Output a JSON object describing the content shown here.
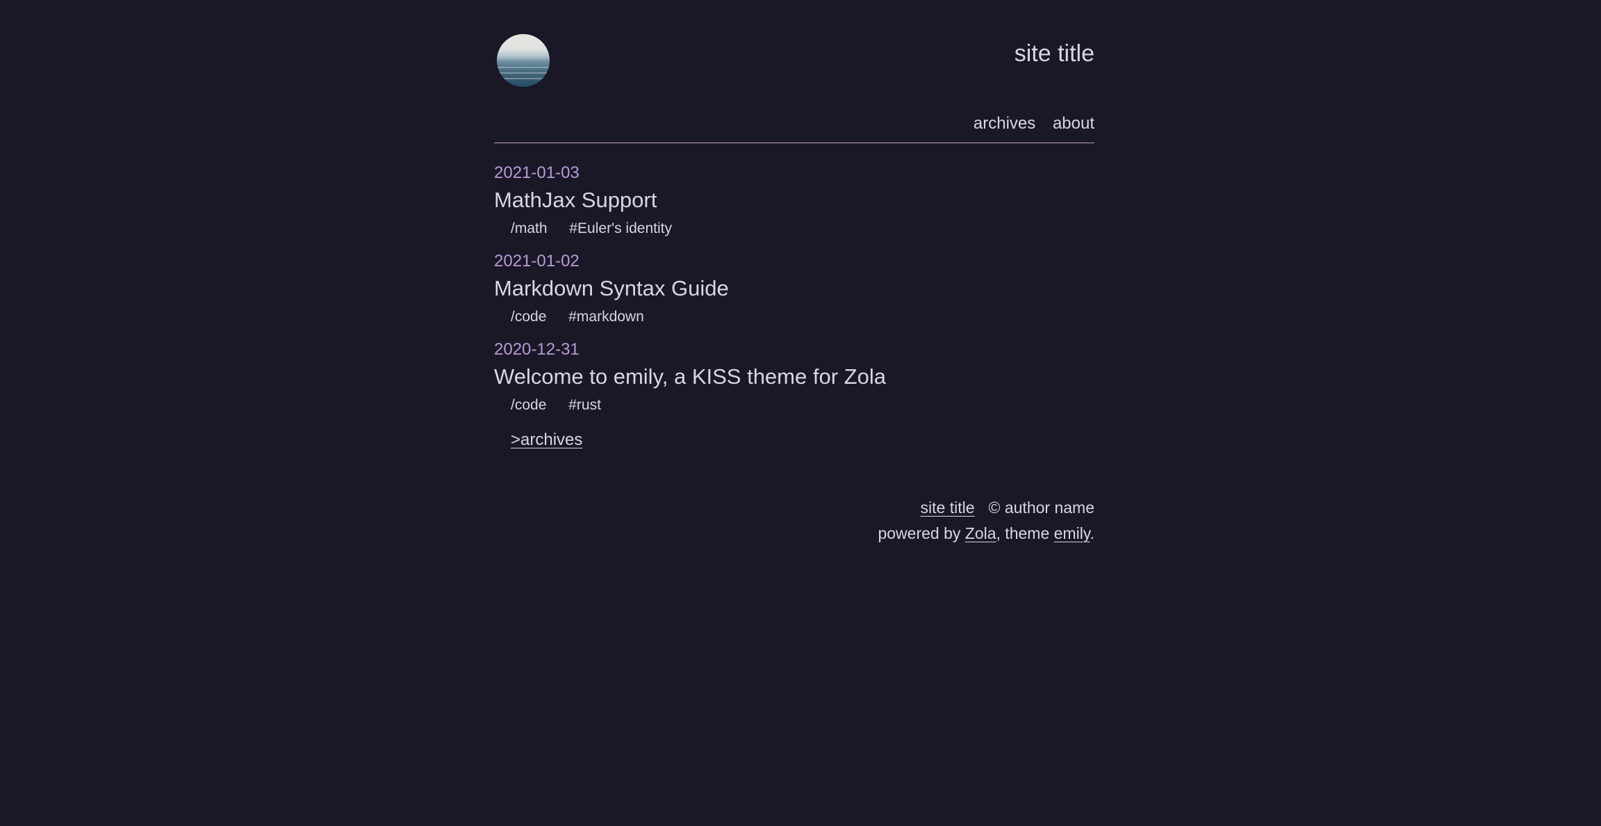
{
  "header": {
    "avatar_icon": "ocean-horizon-avatar-icon",
    "site_title": "site title",
    "nav": [
      {
        "label": "archives"
      },
      {
        "label": "about"
      }
    ]
  },
  "posts": [
    {
      "date": "2021-01-03",
      "title": "MathJax Support",
      "category": "/math",
      "tag": "#Euler's identity"
    },
    {
      "date": "2021-01-02",
      "title": "Markdown Syntax Guide",
      "category": "/code",
      "tag": "#markdown"
    },
    {
      "date": "2020-12-31",
      "title": "Welcome to emily, a KISS theme for Zola",
      "category": "/code",
      "tag": "#rust"
    }
  ],
  "more_link": ">archives",
  "footer": {
    "site_title": "site title",
    "copyright": "© author name",
    "powered_prefix": "powered by ",
    "zola": "Zola",
    "theme_prefix": ", theme ",
    "emily": "emily",
    "period": "."
  },
  "colors": {
    "background": "#1a1826",
    "text": "#d9d6e2",
    "date_accent": "#b79bd8",
    "divider": "#b8a0c0"
  }
}
